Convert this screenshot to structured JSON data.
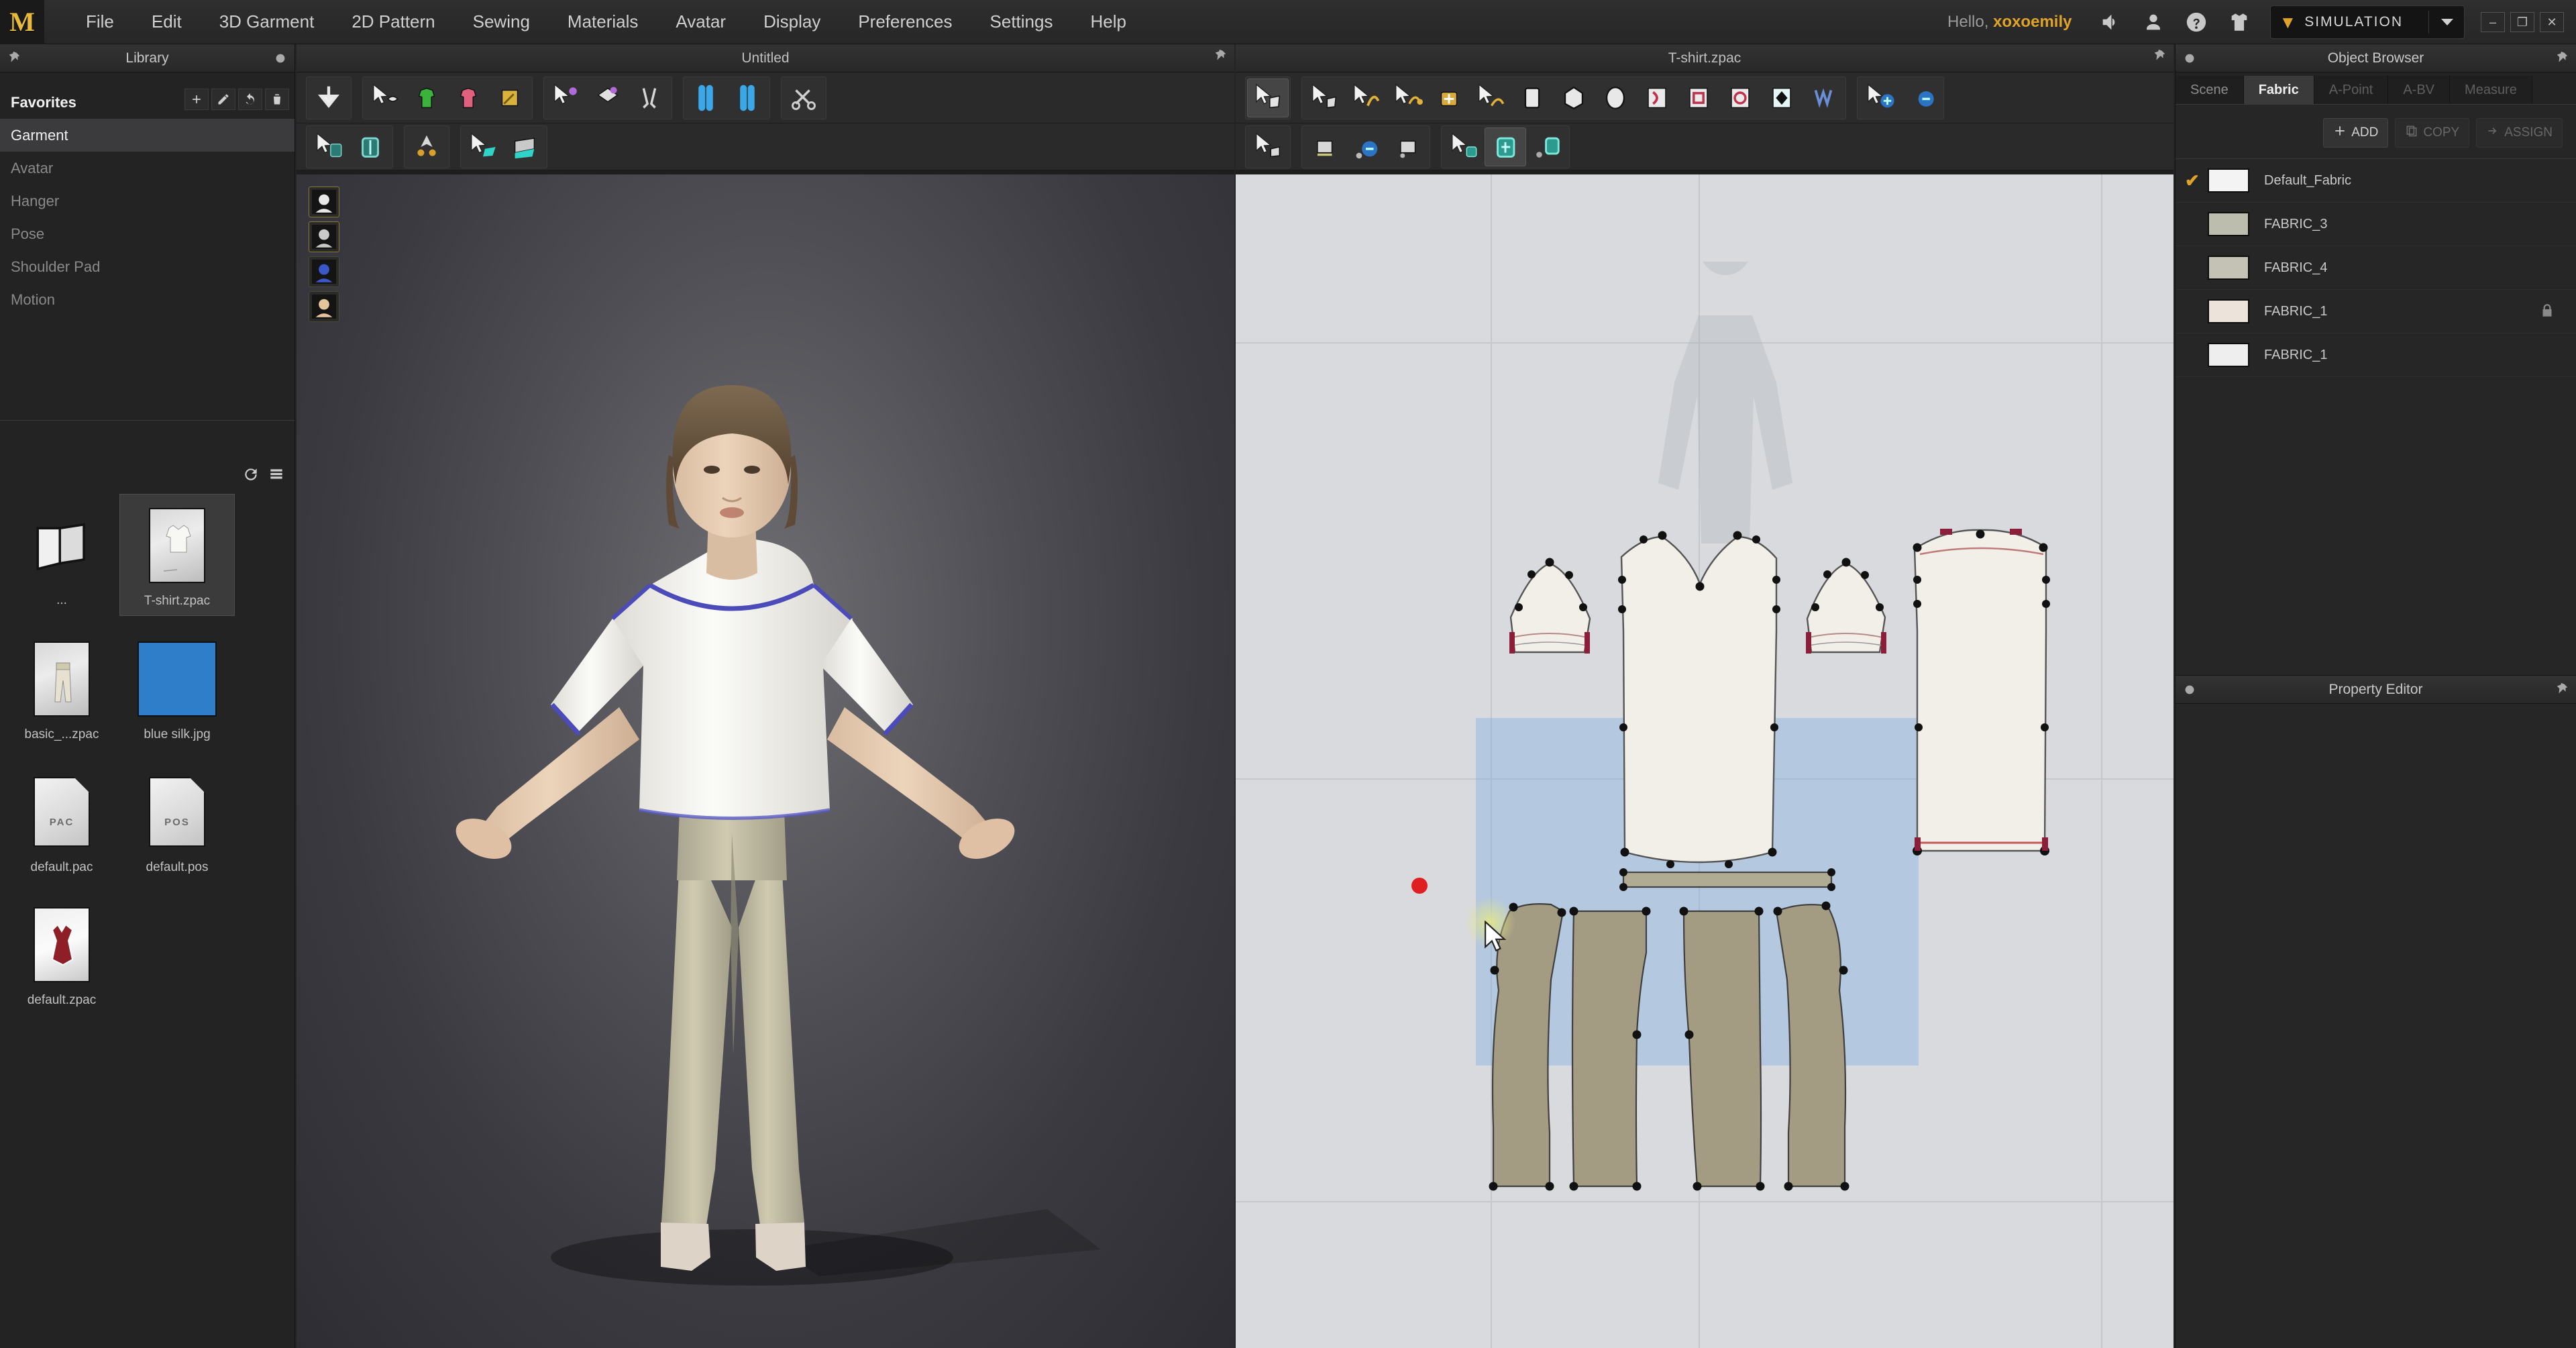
{
  "app": {
    "logo": "M",
    "menu": [
      "File",
      "Edit",
      "3D Garment",
      "2D Pattern",
      "Sewing",
      "Materials",
      "Avatar",
      "Display",
      "Preferences",
      "Settings",
      "Help"
    ],
    "greeting_prefix": "Hello, ",
    "username": "xoxoemily",
    "simulation_label": "SIMULATION",
    "window_buttons": [
      "–",
      "❐",
      "✕"
    ],
    "accent_gold": "#e0a32a",
    "selection_blue": "#78aae6"
  },
  "library": {
    "title": "Library",
    "tree": [
      {
        "label": "Favorites",
        "state": "bold"
      },
      {
        "label": "Garment",
        "state": "selected"
      },
      {
        "label": "Avatar",
        "state": "dim"
      },
      {
        "label": "Hanger",
        "state": "dim"
      },
      {
        "label": "Pose",
        "state": "dim"
      },
      {
        "label": "Shoulder Pad",
        "state": "dim"
      },
      {
        "label": "Motion",
        "state": "dim"
      }
    ],
    "tree_tools": [
      "add-folder-icon",
      "edit-icon",
      "undo-icon",
      "delete-icon"
    ],
    "file_tools": [
      "refresh-icon",
      "list-view-icon"
    ],
    "files": [
      {
        "label": "...",
        "type": "folder",
        "selected": false
      },
      {
        "label": "T-shirt.zpac",
        "type": "garment-thumb",
        "selected": true
      },
      {
        "label": "basic_...zpac",
        "type": "pants-thumb",
        "selected": false
      },
      {
        "label": "blue silk.jpg",
        "type": "color-swatch",
        "color": "#2f7ec9",
        "selected": false
      },
      {
        "label": "default.pac",
        "type": "doc",
        "ext": "PAC",
        "selected": false
      },
      {
        "label": "default.pos",
        "type": "doc",
        "ext": "POS",
        "selected": false
      },
      {
        "label": "default.zpac",
        "type": "dress-thumb",
        "selected": false
      }
    ]
  },
  "view3d": {
    "title": "Untitled",
    "toolbar_groups": [
      {
        "tools": [
          {
            "name": "gravity-drop-icon",
            "active": false
          }
        ]
      },
      {
        "tools": [
          {
            "name": "select-mesh-icon",
            "active": false
          },
          {
            "name": "select-garment-green-icon",
            "active": false
          },
          {
            "name": "select-garment-pink-icon",
            "active": false
          },
          {
            "name": "fabric-brush-icon",
            "active": false
          }
        ]
      },
      {
        "tools": [
          {
            "name": "pin-select-icon",
            "active": false
          },
          {
            "name": "fold-arrangement-icon",
            "active": false
          },
          {
            "name": "tack-icon",
            "active": false
          }
        ]
      },
      {
        "tools": [
          {
            "name": "show-avatar-icon",
            "active": false
          },
          {
            "name": "avatar-gizmo-icon",
            "active": false
          }
        ]
      },
      {
        "tools": [
          {
            "name": "scissors-icon",
            "active": false
          }
        ]
      }
    ],
    "toolbar_row2": [
      {
        "tools": [
          {
            "name": "select-box-icon",
            "active": false
          },
          {
            "name": "box-transform-icon",
            "active": false
          }
        ]
      },
      {
        "tools": [
          {
            "name": "arrow-gizmo-icon",
            "active": false
          }
        ]
      },
      {
        "tools": [
          {
            "name": "select-plane-icon",
            "active": false
          },
          {
            "name": "plane-create-icon",
            "active": false
          }
        ]
      }
    ],
    "gizmos": [
      "avatar-head-icon",
      "avatar-bust-icon",
      "skin-offset-icon",
      "avatar-face-icon"
    ],
    "scene": {
      "avatar_skin": "#e8cdb4",
      "hair_color": "#6b5540",
      "shirt_color": "#f4f3f0",
      "shirt_seam_color": "#4444b4",
      "pants_color": "#bfbba6",
      "shoe_color": "#d8cfc4"
    }
  },
  "view2d": {
    "title": "T-shirt.zpac",
    "toolbar_groups": [
      {
        "tools": [
          {
            "name": "select-pattern-icon",
            "active": true
          }
        ]
      },
      {
        "tools": [
          {
            "name": "transform-pattern-icon",
            "active": false
          },
          {
            "name": "edit-curve-icon",
            "active": false
          },
          {
            "name": "edit-curve-point-icon",
            "active": false
          },
          {
            "name": "add-point-icon",
            "active": false
          },
          {
            "name": "edit-curvature-icon",
            "active": false
          },
          {
            "name": "rectangle-pattern-icon",
            "active": false
          },
          {
            "name": "polygon-pattern-icon",
            "active": false
          },
          {
            "name": "circle-pattern-icon",
            "active": false
          },
          {
            "name": "internal-line-icon",
            "active": false
          },
          {
            "name": "internal-rect-icon",
            "active": false
          },
          {
            "name": "internal-circle-icon",
            "active": false
          },
          {
            "name": "dart-icon",
            "active": false
          },
          {
            "name": "pleat-icon",
            "active": false
          }
        ]
      },
      {
        "tools": [
          {
            "name": "select-sewing-icon",
            "active": false
          },
          {
            "name": "free-sewing-icon",
            "active": false
          }
        ]
      }
    ],
    "toolbar_row2": [
      {
        "tools": [
          {
            "name": "select-segment-sew-icon",
            "active": false
          }
        ]
      },
      {
        "tools": [
          {
            "name": "segment-sewing-icon",
            "active": false
          },
          {
            "name": "free-sewing-multi-icon",
            "active": false
          },
          {
            "name": "auto-sewing-icon",
            "active": false
          }
        ]
      },
      {
        "tools": [
          {
            "name": "select-texture-icon",
            "active": false
          },
          {
            "name": "edit-texture-icon",
            "active": true
          },
          {
            "name": "texture-offset-icon",
            "active": false
          }
        ]
      }
    ],
    "patterns": [
      {
        "name": "sleeve-left",
        "fill": "#f2efe8",
        "group": "tshirt"
      },
      {
        "name": "front-bodice",
        "fill": "#f2efe8",
        "group": "tshirt"
      },
      {
        "name": "sleeve-right",
        "fill": "#f2efe8",
        "group": "tshirt"
      },
      {
        "name": "back-bodice",
        "fill": "#f2efe8",
        "group": "tshirt"
      },
      {
        "name": "waistband",
        "fill": "#b0ab93",
        "group": "pants"
      },
      {
        "name": "pants-front-left",
        "fill": "#a39b82",
        "group": "pants",
        "selected": true
      },
      {
        "name": "pants-front-right",
        "fill": "#a39b82",
        "group": "pants",
        "selected": true
      },
      {
        "name": "pants-back-left",
        "fill": "#a39b82",
        "group": "pants",
        "selected": true
      },
      {
        "name": "pants-back-right",
        "fill": "#a39b82",
        "group": "pants",
        "selected": true
      }
    ],
    "pattern_fill_tshirt": "#f2efe8",
    "pattern_fill_pants": "#a39b82",
    "canvas_bg": "#d8dadd",
    "marker_color": "#e02020"
  },
  "object_browser": {
    "title": "Object Browser",
    "tabs": [
      {
        "label": "Scene",
        "active": false
      },
      {
        "label": "Fabric",
        "active": true
      },
      {
        "label": "A-Point",
        "active": false,
        "disabled": true
      },
      {
        "label": "A-BV",
        "active": false,
        "disabled": true
      },
      {
        "label": "Measure",
        "active": false,
        "disabled": true
      }
    ],
    "actions": [
      {
        "label": "ADD",
        "icon": "plus-icon",
        "disabled": false
      },
      {
        "label": "COPY",
        "icon": "copy-icon",
        "disabled": true
      },
      {
        "label": "ASSIGN",
        "icon": "assign-icon",
        "disabled": true
      }
    ],
    "fabrics": [
      {
        "name": "Default_Fabric",
        "checked": true,
        "swatch": "#f3f3f3",
        "locked": false
      },
      {
        "name": "FABRIC_3",
        "checked": false,
        "swatch": "#bdbdae",
        "locked": false
      },
      {
        "name": "FABRIC_4",
        "checked": false,
        "swatch": "#c3c2b4",
        "locked": false
      },
      {
        "name": "FABRIC_1",
        "checked": false,
        "swatch": "#ece4da",
        "locked": true
      },
      {
        "name": "FABRIC_1",
        "checked": false,
        "swatch": "#eeeeee",
        "locked": false
      }
    ]
  },
  "property_editor": {
    "title": "Property Editor"
  }
}
